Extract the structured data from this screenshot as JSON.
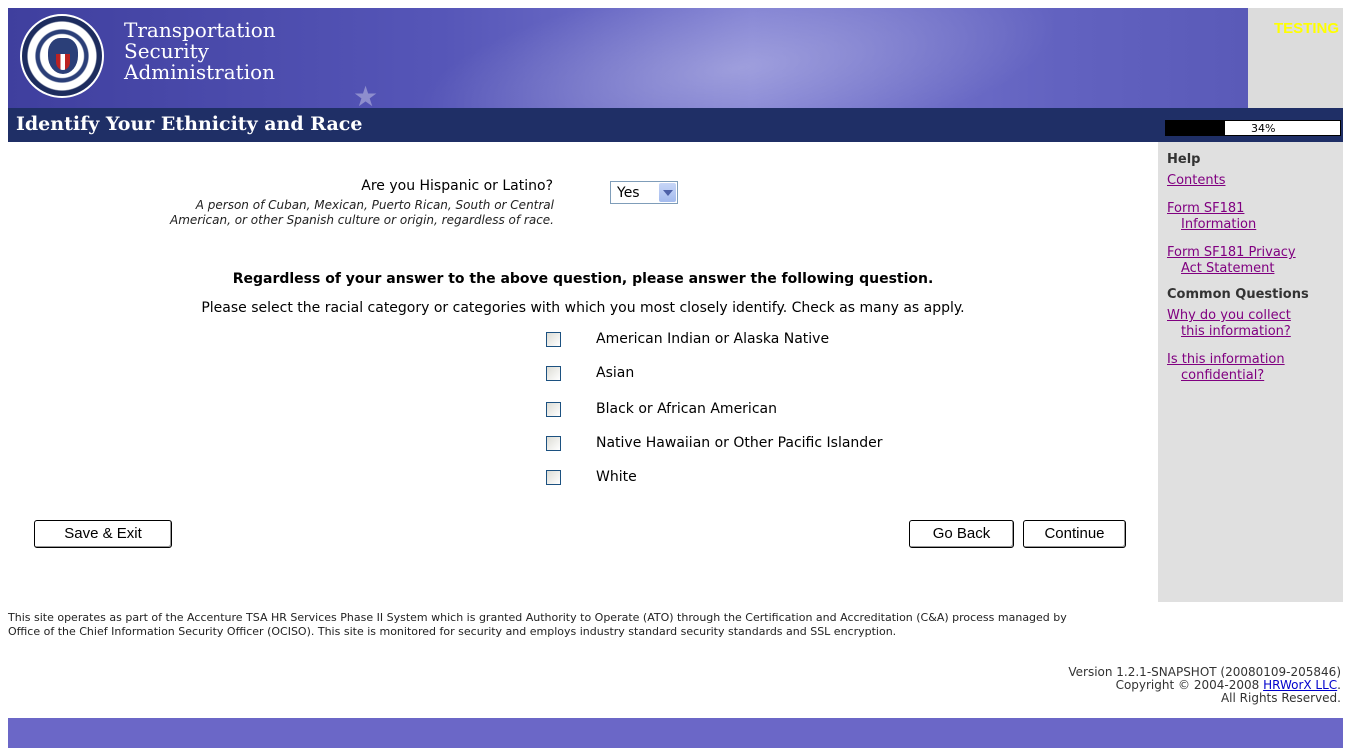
{
  "header": {
    "agency_line1": "Transportation",
    "agency_line2": "Security",
    "agency_line3": "Administration",
    "env_label": "TESTING"
  },
  "page": {
    "title": "Identify Your Ethnicity and Race",
    "progress_label": "34%",
    "progress_value": 0.34
  },
  "form": {
    "hispanic_question": "Are you Hispanic or Latino?",
    "hispanic_desc_line1": "A person of Cuban, Mexican, Puerto Rican, South or Central",
    "hispanic_desc_line2": "American, or other Spanish culture or origin, regardless of race.",
    "hispanic_selected": "Yes",
    "race_heading": "Regardless of your answer to the above question, please answer the following question.",
    "race_instruction": "Please select the racial category or categories with which you most closely identify. Check as many as apply.",
    "race_options": [
      {
        "label": "American Indian or Alaska Native",
        "checked": false
      },
      {
        "label": "Asian",
        "checked": false
      },
      {
        "label": "Black or African American",
        "checked": false
      },
      {
        "label": "Native Hawaiian or Other Pacific Islander",
        "checked": false
      },
      {
        "label": "White",
        "checked": false
      }
    ]
  },
  "buttons": {
    "save_exit": "Save & Exit",
    "go_back": "Go Back",
    "continue": "Continue"
  },
  "sidebar": {
    "help_heading": "Help",
    "help_links": [
      {
        "line1": "Contents",
        "line2": ""
      },
      {
        "line1": "Form SF181",
        "line2": "Information"
      },
      {
        "line1": "Form SF181 Privacy",
        "line2": "Act Statement"
      }
    ],
    "questions_heading": "Common Questions",
    "question_links": [
      {
        "line1": "Why do you collect",
        "line2": "this information?"
      },
      {
        "line1": "Is this information",
        "line2": "confidential?"
      }
    ]
  },
  "footer": {
    "notice_line1": "This site operates as part of the Accenture TSA HR Services Phase II System which is granted Authority to Operate (ATO) through the Certification and Accreditation (C&A) process managed by",
    "notice_line2": "Office of the Chief Information Security Officer (OCISO). This site is monitored for security and employs industry standard security standards and SSL encryption.",
    "version": "Version 1.2.1-SNAPSHOT (20080109-205846)",
    "copyright_prefix": "Copyright © 2004-2008 ",
    "copyright_link": "HRWorX LLC",
    "copyright_suffix": ".",
    "rights": "All Rights Reserved."
  },
  "colors": {
    "title_bar": "#1f2f66",
    "banner": "#5656b8",
    "sidebar": "#e0e0e0",
    "bottom_bar": "#6b67c7",
    "env_label": "#ffff00"
  }
}
